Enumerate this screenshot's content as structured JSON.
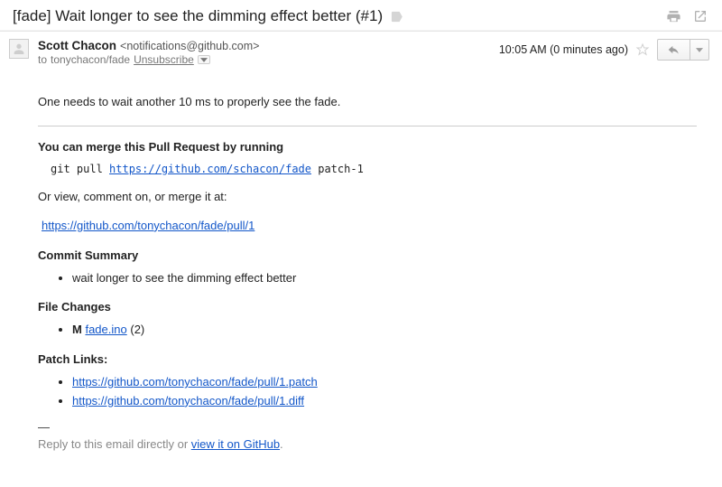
{
  "subject": "[fade] Wait longer to see the dimming effect better (#1)",
  "header": {
    "from_name": "Scott Chacon",
    "from_addr": "<notifications@github.com>",
    "to_prefix": "to",
    "to": "tonychacon/fade",
    "unsubscribe": "Unsubscribe",
    "timestamp": "10:05 AM (0 minutes ago)"
  },
  "body": {
    "intro": "One needs to wait another 10 ms to properly see the fade.",
    "merge_heading": "You can merge this Pull Request by running",
    "git_cmd_prefix": "git pull ",
    "git_cmd_url": "https://github.com/schacon/fade",
    "git_cmd_branch": " patch-1",
    "or_text": "Or view, comment on, or merge it at:",
    "pr_url": "https://github.com/tonychacon/fade/pull/1",
    "commit_heading": "Commit Summary",
    "commit_items": [
      "wait longer to see the dimming effect better"
    ],
    "file_heading": "File Changes",
    "file_change_flag": "M",
    "file_change_name": "fade.ino",
    "file_change_count": "(2)",
    "patch_heading": "Patch Links:",
    "patch_links": [
      "https://github.com/tonychacon/fade/pull/1.patch",
      "https://github.com/tonychacon/fade/pull/1.diff"
    ],
    "sig_dash": "—",
    "reply_prefix": "Reply to this email directly or ",
    "reply_link": "view it on GitHub",
    "reply_suffix": "."
  }
}
